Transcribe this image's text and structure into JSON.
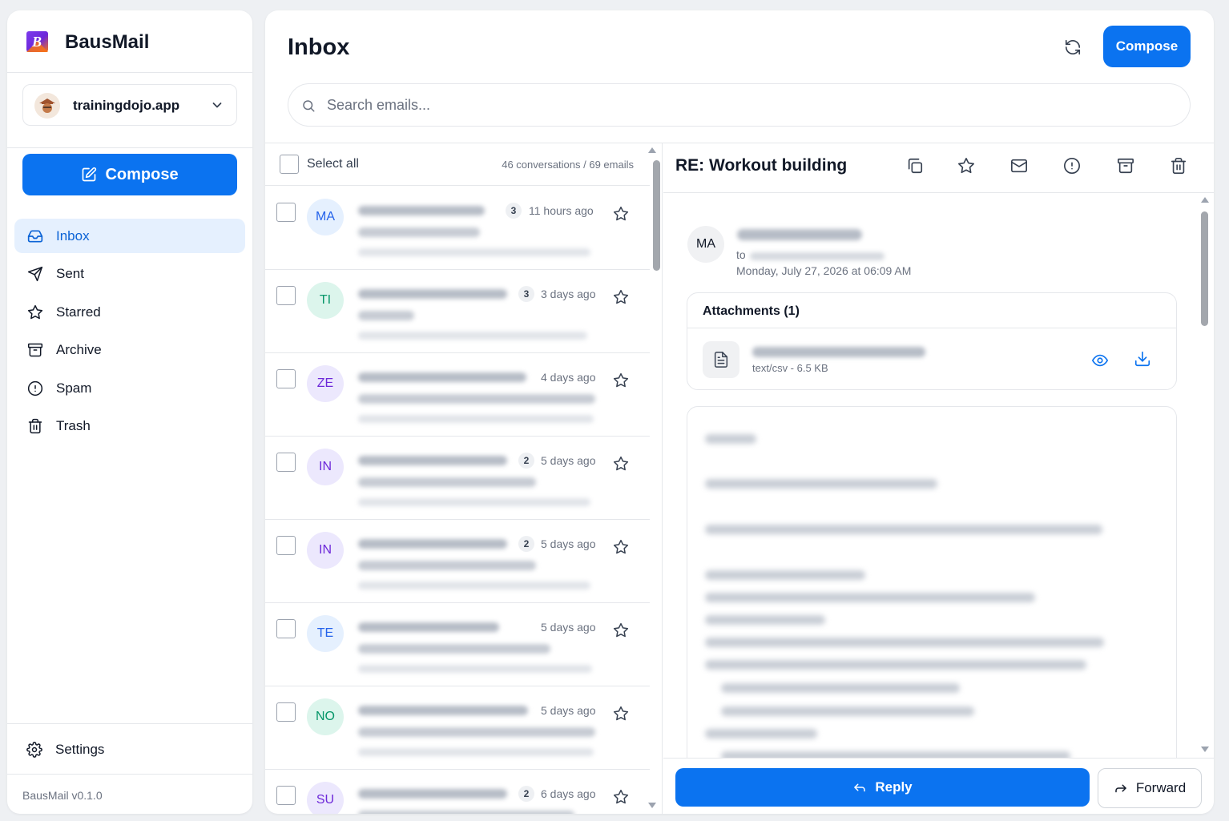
{
  "app": {
    "name": "BausMail",
    "version": "BausMail v0.1.0",
    "accent": "#0b73f0"
  },
  "sidebar": {
    "account": "trainingdojo.app",
    "compose_label": "Compose",
    "items": [
      {
        "label": "Inbox",
        "icon": "inbox-icon",
        "active": true
      },
      {
        "label": "Sent",
        "icon": "send-icon"
      },
      {
        "label": "Starred",
        "icon": "star-icon"
      },
      {
        "label": "Archive",
        "icon": "archive-icon"
      },
      {
        "label": "Spam",
        "icon": "alert-circle-icon"
      },
      {
        "label": "Trash",
        "icon": "trash-icon"
      }
    ],
    "settings_label": "Settings"
  },
  "main": {
    "title": "Inbox",
    "compose_label": "Compose",
    "search_placeholder": "Search emails..."
  },
  "list": {
    "select_all_label": "Select all",
    "counts": "46 conversations / 69 emails",
    "rows": [
      {
        "initials": "MA",
        "count": "3",
        "time": "11 hours ago",
        "avatar_bg": "#e5f0fe",
        "avatar_fg": "#2563eb"
      },
      {
        "initials": "TI",
        "count": "3",
        "time": "3 days ago",
        "avatar_bg": "#dcf5ec",
        "avatar_fg": "#059669"
      },
      {
        "initials": "ZE",
        "count": "",
        "time": "4 days ago",
        "avatar_bg": "#ece8fd",
        "avatar_fg": "#6d28d9"
      },
      {
        "initials": "IN",
        "count": "2",
        "time": "5 days ago",
        "avatar_bg": "#ece8fd",
        "avatar_fg": "#6d28d9"
      },
      {
        "initials": "IN",
        "count": "2",
        "time": "5 days ago",
        "avatar_bg": "#ece8fd",
        "avatar_fg": "#6d28d9"
      },
      {
        "initials": "TE",
        "count": "",
        "time": "5 days ago",
        "avatar_bg": "#e5f0fe",
        "avatar_fg": "#2563eb"
      },
      {
        "initials": "NO",
        "count": "",
        "time": "5 days ago",
        "avatar_bg": "#dcf5ec",
        "avatar_fg": "#059669"
      },
      {
        "initials": "SU",
        "count": "2",
        "time": "6 days ago",
        "avatar_bg": "#ece8fd",
        "avatar_fg": "#6d28d9"
      }
    ]
  },
  "reader": {
    "subject": "RE: Workout building",
    "sender_initials": "MA",
    "to_label": "to",
    "date": "Monday, July 27, 2026 at 06:09 AM",
    "attachments_title": "Attachments (1)",
    "attachment_meta": "text/csv - 6.5 KB",
    "reply_label": "Reply",
    "forward_label": "Forward"
  }
}
